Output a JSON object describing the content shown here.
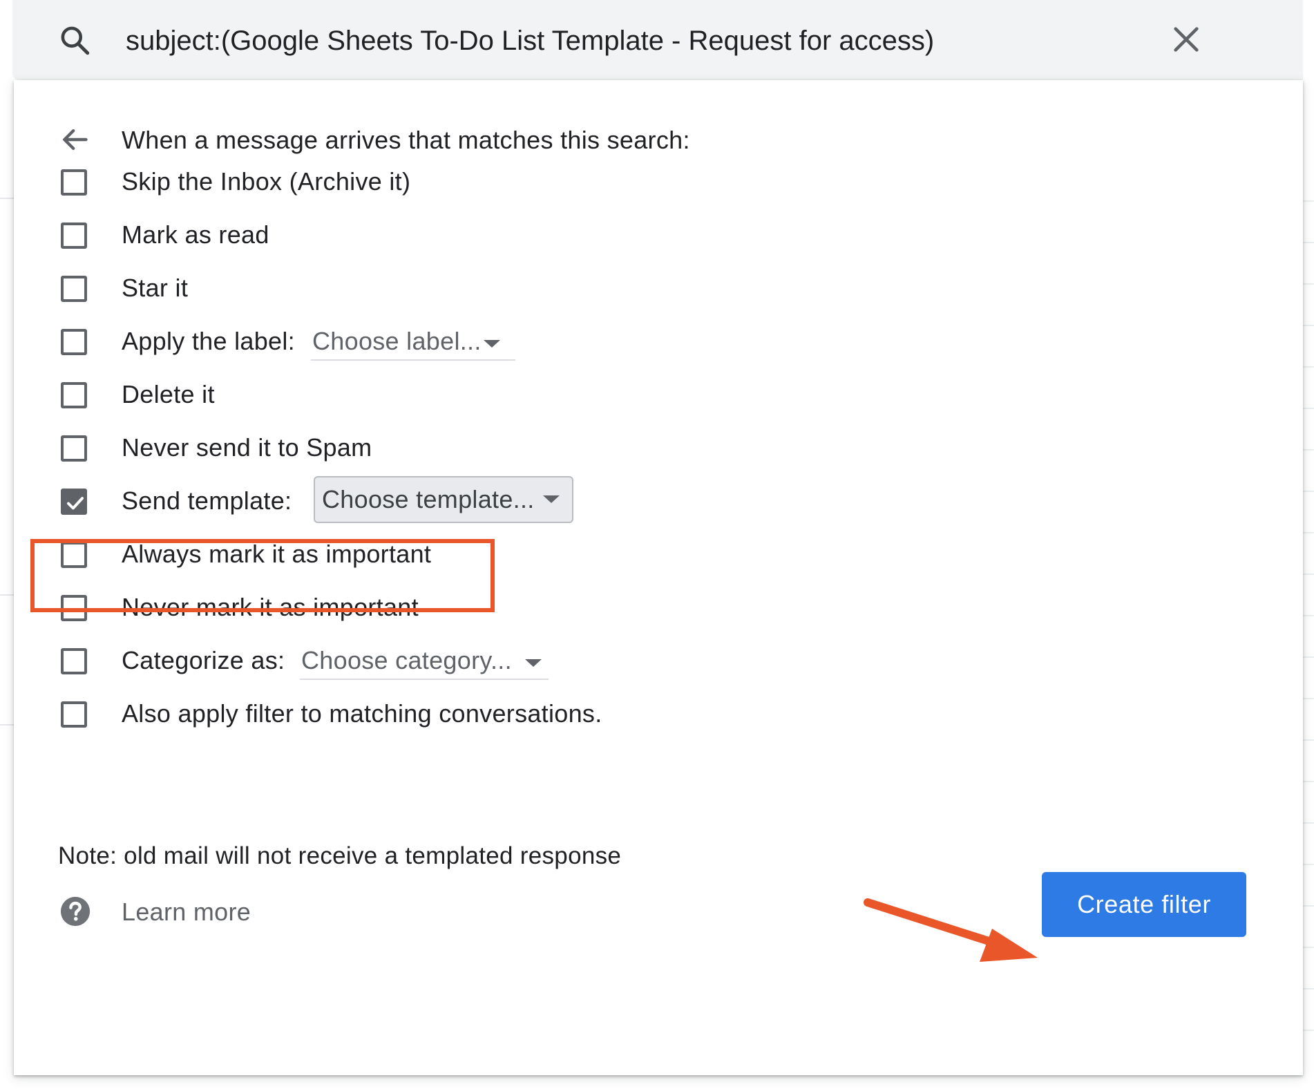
{
  "search": {
    "query": "subject:(Google Sheets To-Do List Template - Request for access)",
    "search_icon": "search-icon",
    "close_icon": "close-icon"
  },
  "panel": {
    "back_icon": "arrow-left-icon",
    "header": "When a message arrives that matches this search:",
    "options": {
      "skip_inbox": {
        "label": "Skip the Inbox (Archive it)",
        "checked": false
      },
      "mark_read": {
        "label": "Mark as read",
        "checked": false
      },
      "star": {
        "label": "Star it",
        "checked": false
      },
      "apply_label": {
        "label": "Apply the label:",
        "select": "Choose label...",
        "checked": false
      },
      "delete": {
        "label": "Delete it",
        "checked": false
      },
      "never_spam": {
        "label": "Never send it to Spam",
        "checked": false
      },
      "send_template": {
        "label": "Send template:",
        "select": "Choose template...",
        "checked": true
      },
      "always_important": {
        "label": "Always mark it as important",
        "checked": false
      },
      "never_important": {
        "label": "Never mark it as important",
        "checked": false
      },
      "categorize": {
        "label": "Categorize as:",
        "select": "Choose category...",
        "checked": false
      },
      "also_apply": {
        "label": "Also apply filter to matching conversations.",
        "checked": false
      }
    },
    "note": "Note: old mail will not receive a templated response",
    "help_icon": "help-circle-icon",
    "learn_more": "Learn more",
    "create_button": "Create filter"
  },
  "colors": {
    "accent_button": "#2f7be6",
    "annotation": "#e8562a",
    "checkbox": "#5f6368",
    "search_bar": "#f1f3f4"
  }
}
